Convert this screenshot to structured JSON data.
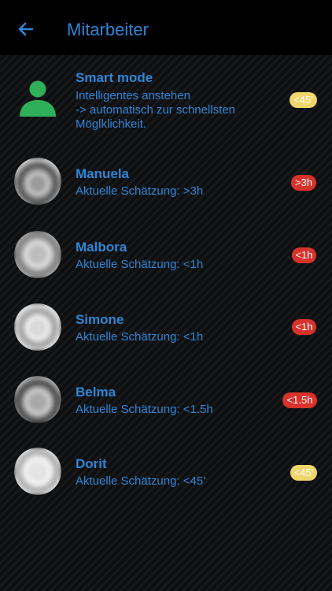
{
  "header": {
    "title": "Mitarbeiter",
    "back_icon": "arrow-left-icon"
  },
  "smart_mode": {
    "name": "Smart mode",
    "description_line1": "Intelligentes anstehen",
    "description_line2": "-> automatisch zur schnellsten",
    "description_line3": "Möglklichkeit.",
    "badge": "<45'",
    "badge_color": "#f0d66a",
    "icon": "person-icon",
    "icon_color": "#2eb05a"
  },
  "employees": [
    {
      "name": "Manuela",
      "estimate_label": "Aktuelle Schätzung:",
      "estimate_value": ">3h",
      "badge": ">3h",
      "badge_status": "red"
    },
    {
      "name": "Malbora",
      "estimate_label": "Aktuelle Schätzung:",
      "estimate_value": "<1h",
      "badge": "<1h",
      "badge_status": "red"
    },
    {
      "name": "Simone",
      "estimate_label": "Aktuelle Schätzung:",
      "estimate_value": "<1h",
      "badge": "<1h",
      "badge_status": "red"
    },
    {
      "name": "Belma",
      "estimate_label": "Aktuelle Schätzung:",
      "estimate_value": "<1.5h",
      "badge": "<1.5h",
      "badge_status": "red"
    },
    {
      "name": "Dorit",
      "estimate_label": "Aktuelle Schätzung:",
      "estimate_value": "<45'",
      "badge": "<45'",
      "badge_status": "yellow"
    }
  ],
  "colors": {
    "accent": "#2f86d6",
    "badge_red": "#d7332c",
    "badge_yellow": "#f0d66a",
    "appbar": "#000000"
  }
}
